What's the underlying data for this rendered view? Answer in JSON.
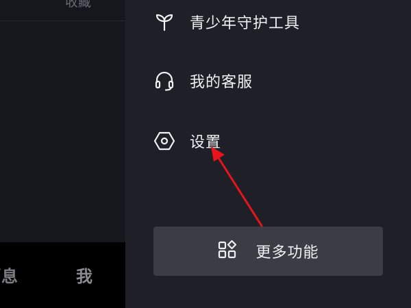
{
  "left": {
    "top_label": "收藏",
    "tabs": {
      "messages": "消息",
      "me": "我"
    }
  },
  "drawer": {
    "items": [
      {
        "label": "青少年守护工具",
        "icon": "sprout-icon"
      },
      {
        "label": "我的客服",
        "icon": "headset-icon"
      },
      {
        "label": "设置",
        "icon": "hexagon-settings-icon"
      }
    ],
    "more_button": {
      "label": "更多功能",
      "icon": "apps-grid-icon"
    }
  },
  "annotation": {
    "color": "#e8141b"
  }
}
